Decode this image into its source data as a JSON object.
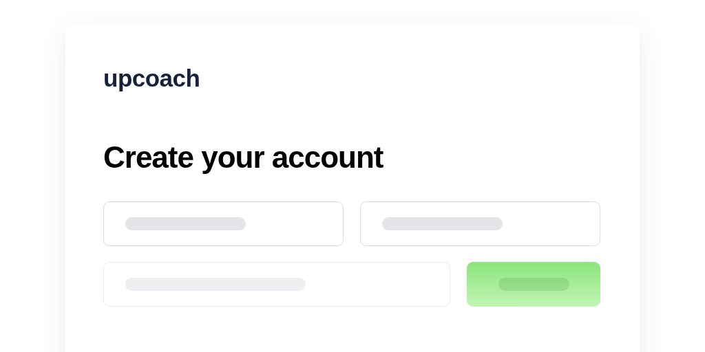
{
  "logo": "upcoach",
  "heading": "Create your account",
  "form_rows": [
    {
      "items": [
        {
          "kind": "field"
        },
        {
          "kind": "field"
        }
      ]
    },
    {
      "items": [
        {
          "kind": "field"
        },
        {
          "kind": "button"
        }
      ]
    }
  ]
}
